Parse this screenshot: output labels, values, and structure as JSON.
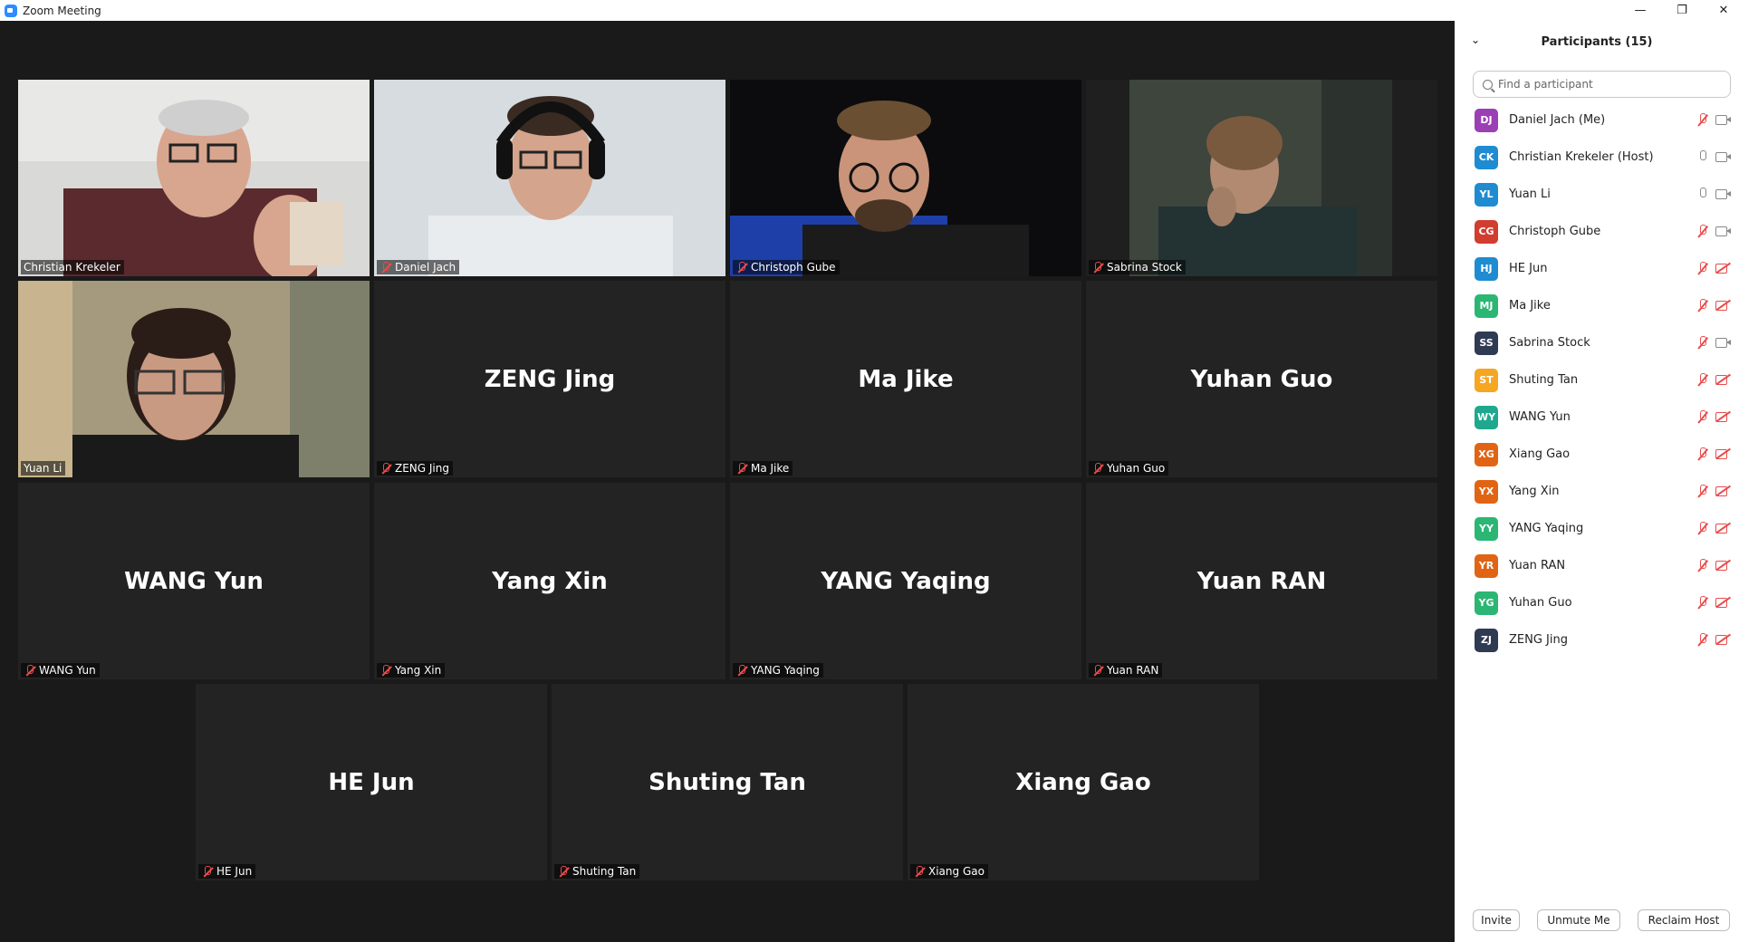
{
  "window": {
    "title": "Zoom Meeting",
    "controls": {
      "minimize": "—",
      "restore": "❐",
      "close": "✕"
    }
  },
  "gallery": {
    "active_speaker": "Christian Krekeler",
    "tiles": [
      {
        "name": "Christian Krekeler",
        "video": true,
        "muted": false,
        "active": true
      },
      {
        "name": "Daniel Jach",
        "video": true,
        "muted": true
      },
      {
        "name": "Christoph Gube",
        "video": true,
        "muted": true
      },
      {
        "name": "Sabrina Stock",
        "video": true,
        "muted": true
      },
      {
        "name": "Yuan Li",
        "video": true,
        "muted": false
      },
      {
        "name": "ZENG Jing",
        "video": false,
        "muted": true
      },
      {
        "name": "Ma Jike",
        "video": false,
        "muted": true
      },
      {
        "name": "Yuhan Guo",
        "video": false,
        "muted": true
      },
      {
        "name": "WANG Yun",
        "video": false,
        "muted": true
      },
      {
        "name": "Yang Xin",
        "video": false,
        "muted": true
      },
      {
        "name": "YANG Yaqing",
        "video": false,
        "muted": true
      },
      {
        "name": "Yuan RAN",
        "video": false,
        "muted": true
      },
      {
        "name": "HE Jun",
        "video": false,
        "muted": true
      },
      {
        "name": "Shuting Tan",
        "video": false,
        "muted": true
      },
      {
        "name": "Xiang Gao",
        "video": false,
        "muted": true
      }
    ]
  },
  "panel": {
    "title": "Participants (15)",
    "search_placeholder": "Find a participant",
    "participants": [
      {
        "initials": "DJ",
        "name": "Daniel Jach (Me)",
        "color": "#9b3fb5",
        "mic": "off",
        "cam": "on"
      },
      {
        "initials": "CK",
        "name": "Christian Krekeler (Host)",
        "color": "#1f8bd1",
        "mic": "on",
        "cam": "on"
      },
      {
        "initials": "YL",
        "name": "Yuan Li",
        "color": "#1f8bd1",
        "mic": "on",
        "cam": "on"
      },
      {
        "initials": "CG",
        "name": "Christoph Gube",
        "color": "#d13d2f",
        "mic": "off",
        "cam": "on"
      },
      {
        "initials": "HJ",
        "name": "HE Jun",
        "color": "#1f8bd1",
        "mic": "off",
        "cam": "off"
      },
      {
        "initials": "MJ",
        "name": "Ma Jike",
        "color": "#2bb673",
        "mic": "off",
        "cam": "off"
      },
      {
        "initials": "SS",
        "name": "Sabrina Stock",
        "color": "#2f3b52",
        "mic": "off",
        "cam": "on"
      },
      {
        "initials": "ST",
        "name": "Shuting Tan",
        "color": "#f5a623",
        "mic": "off",
        "cam": "off"
      },
      {
        "initials": "WY",
        "name": "WANG Yun",
        "color": "#1fa88d",
        "mic": "off",
        "cam": "off"
      },
      {
        "initials": "XG",
        "name": "Xiang Gao",
        "color": "#e06414",
        "mic": "off",
        "cam": "off"
      },
      {
        "initials": "YX",
        "name": "Yang Xin",
        "color": "#e06414",
        "mic": "off",
        "cam": "off"
      },
      {
        "initials": "YY",
        "name": "YANG Yaqing",
        "color": "#2bb673",
        "mic": "off",
        "cam": "off"
      },
      {
        "initials": "YR",
        "name": "Yuan RAN",
        "color": "#e06414",
        "mic": "off",
        "cam": "off"
      },
      {
        "initials": "YG",
        "name": "Yuhan Guo",
        "color": "#2bb673",
        "mic": "off",
        "cam": "off"
      },
      {
        "initials": "ZJ",
        "name": "ZENG Jing",
        "color": "#2f3b52",
        "mic": "off",
        "cam": "off"
      }
    ],
    "buttons": {
      "invite": "Invite",
      "unmute": "Unmute Me",
      "reclaim": "Reclaim Host"
    }
  }
}
